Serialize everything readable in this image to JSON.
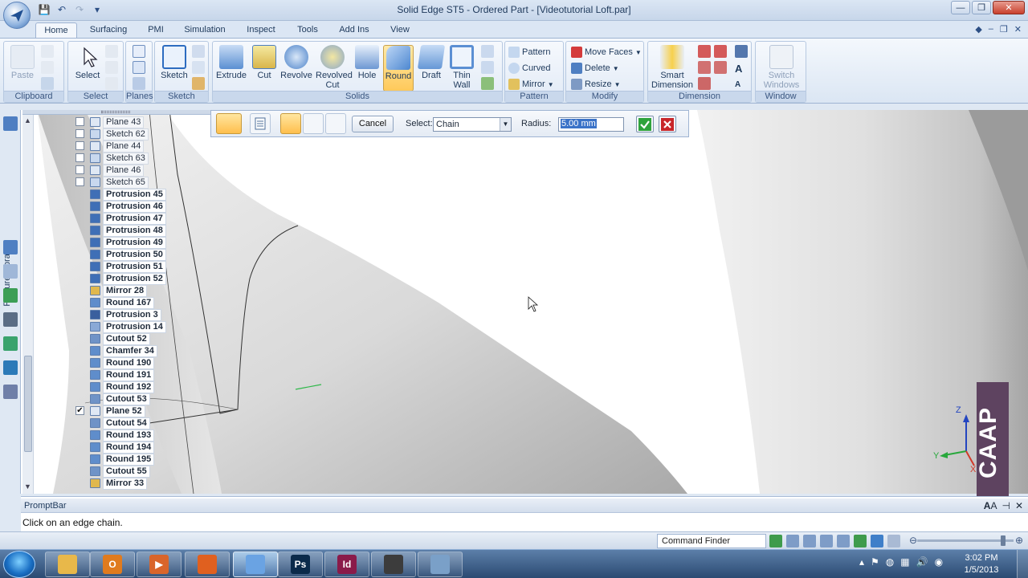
{
  "window": {
    "title": "Solid Edge ST5 - Ordered Part - [Videotutorial Loft.par]"
  },
  "tabs": [
    "Home",
    "Surfacing",
    "Simulation",
    "PMI",
    "Inspect",
    "Tools",
    "Add Ins",
    "View"
  ],
  "ribbon": {
    "clipboard": {
      "label": "Clipboard",
      "paste": "Paste"
    },
    "select": {
      "label": "Select",
      "select": "Select"
    },
    "planes": {
      "label": "Planes"
    },
    "sketch": {
      "label": "Sketch",
      "sketch": "Sketch"
    },
    "solids": {
      "label": "Solids",
      "extrude": "Extrude",
      "cut": "Cut",
      "revolve": "Revolve",
      "revolved_cut_1": "Revolved",
      "revolved_cut_2": "Cut",
      "hole": "Hole",
      "round": "Round",
      "draft": "Draft",
      "thin_wall_1": "Thin",
      "thin_wall_2": "Wall"
    },
    "pattern": {
      "label": "Pattern",
      "pattern": "Pattern",
      "curved": "Curved",
      "mirror": "Mirror"
    },
    "modify": {
      "label": "Modify",
      "move_faces": "Move Faces",
      "delete": "Delete",
      "resize": "Resize"
    },
    "dimension": {
      "label": "Dimension",
      "smart_1": "Smart",
      "smart_2": "Dimension"
    },
    "window": {
      "label": "Window",
      "switch_1": "Switch",
      "switch_2": "Windows"
    }
  },
  "side_panel": {
    "feature_library": "Feature Library"
  },
  "tree": [
    {
      "label": "Plane 43",
      "icon": "plane",
      "check": "",
      "bold": false
    },
    {
      "label": "Sketch 62",
      "icon": "sketch",
      "check": "",
      "bold": false
    },
    {
      "label": "Plane 44",
      "icon": "plane",
      "check": "",
      "bold": false
    },
    {
      "label": "Sketch 63",
      "icon": "sketch",
      "check": "",
      "bold": false
    },
    {
      "label": "Plane 46",
      "icon": "plane",
      "check": "",
      "bold": false
    },
    {
      "label": "Sketch 65",
      "icon": "sketch",
      "check": "",
      "bold": false
    },
    {
      "label": "Protrusion 45",
      "icon": "protrusion",
      "check": null,
      "bold": true
    },
    {
      "label": "Protrusion 46",
      "icon": "protrusion",
      "check": null,
      "bold": true
    },
    {
      "label": "Protrusion 47",
      "icon": "protrusion",
      "check": null,
      "bold": true
    },
    {
      "label": "Protrusion 48",
      "icon": "protrusion",
      "check": null,
      "bold": true
    },
    {
      "label": "Protrusion 49",
      "icon": "protrusion",
      "check": null,
      "bold": true
    },
    {
      "label": "Protrusion 50",
      "icon": "protrusion",
      "check": null,
      "bold": true
    },
    {
      "label": "Protrusion 51",
      "icon": "protrusion",
      "check": null,
      "bold": true
    },
    {
      "label": "Protrusion 52",
      "icon": "protrusion",
      "check": null,
      "bold": true
    },
    {
      "label": "Mirror 28",
      "icon": "mirror",
      "check": null,
      "bold": true
    },
    {
      "label": "Round 167",
      "icon": "round",
      "check": null,
      "bold": true
    },
    {
      "label": "Protrusion 3",
      "icon": "revolve",
      "check": null,
      "bold": true
    },
    {
      "label": "Protrusion 14",
      "icon": "protrusion2",
      "check": null,
      "bold": true
    },
    {
      "label": "Cutout 52",
      "icon": "cutout",
      "check": null,
      "bold": true
    },
    {
      "label": "Chamfer 34",
      "icon": "round",
      "check": null,
      "bold": true
    },
    {
      "label": "Round 190",
      "icon": "round",
      "check": null,
      "bold": true
    },
    {
      "label": "Round 191",
      "icon": "round",
      "check": null,
      "bold": true
    },
    {
      "label": "Round 192",
      "icon": "round",
      "check": null,
      "bold": true
    },
    {
      "label": "Cutout 53",
      "icon": "cutout",
      "check": null,
      "bold": true
    },
    {
      "label": "Plane 52",
      "icon": "plane",
      "check": "✔",
      "bold": true
    },
    {
      "label": "Cutout 54",
      "icon": "cutout",
      "check": null,
      "bold": true
    },
    {
      "label": "Round 193",
      "icon": "round",
      "check": null,
      "bold": true
    },
    {
      "label": "Round 194",
      "icon": "round",
      "check": null,
      "bold": true
    },
    {
      "label": "Round 195",
      "icon": "round",
      "check": null,
      "bold": true
    },
    {
      "label": "Cutout 55",
      "icon": "cutout",
      "check": null,
      "bold": true
    },
    {
      "label": "Mirror 33",
      "icon": "mirror",
      "check": null,
      "bold": true
    }
  ],
  "command_bar": {
    "cancel": "Cancel",
    "select_label": "Select:",
    "select_value": "Chain",
    "radius_label": "Radius:",
    "radius_value": "5.00 mm"
  },
  "triad": {
    "z": "Z",
    "y": "Y",
    "x": "X"
  },
  "watermark": "CAAP",
  "prompt": {
    "header": "PromptBar",
    "text": "Click on an edge chain."
  },
  "status": {
    "command_finder": "Command Finder"
  },
  "taskbar": {
    "apps": [
      {
        "name": "explorer",
        "text": "",
        "color": "#e8b84a"
      },
      {
        "name": "outlook",
        "text": "O",
        "color": "#e07b1e"
      },
      {
        "name": "media-player",
        "text": "▶",
        "color": "#d9652b"
      },
      {
        "name": "firefox",
        "text": "",
        "color": "#e0601f"
      },
      {
        "name": "solid-edge",
        "text": "",
        "color": "#6aa3e3"
      },
      {
        "name": "photoshop",
        "text": "Ps",
        "color": "#0b2a4a"
      },
      {
        "name": "indesign",
        "text": "Id",
        "color": "#8a1b4a"
      },
      {
        "name": "camtasia",
        "text": "",
        "color": "#3c3c3c"
      },
      {
        "name": "window-app",
        "text": "",
        "color": "#7aa0c8"
      }
    ],
    "time": "3:02 PM",
    "date": "1/5/2013"
  }
}
